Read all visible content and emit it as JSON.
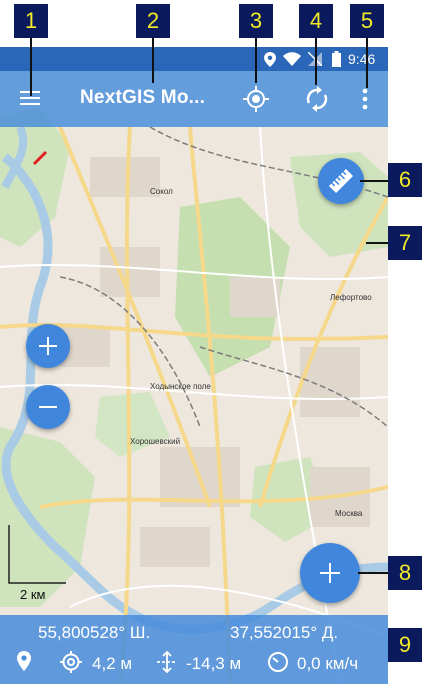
{
  "callouts": [
    "1",
    "2",
    "3",
    "4",
    "5",
    "6",
    "7",
    "8",
    "9"
  ],
  "status_bar": {
    "time": "9:46"
  },
  "app_bar": {
    "title": "NextGIS Mo..."
  },
  "map": {
    "labels": [
      "Москва",
      "Лефортово",
      "Сокол",
      "Ходынское поле",
      "Хорошевский"
    ]
  },
  "scale": {
    "label": "2 км"
  },
  "info_panel": {
    "latitude": "55,800528° Ш.",
    "longitude": "37,552015° Д.",
    "accuracy": "4,2 м",
    "altitude": "-14,3 м",
    "speed": "0,0 км/ч"
  },
  "colors": {
    "accent": "#3f86dc",
    "statusbar": "#2a67b8",
    "callout_bg": "#0b1a5c",
    "callout_text": "#f2ea28"
  }
}
